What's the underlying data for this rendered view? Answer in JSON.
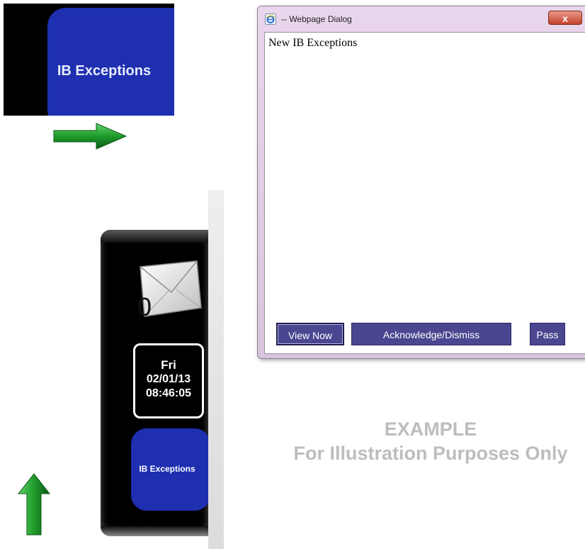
{
  "zoom": {
    "button_label": "IB Exceptions"
  },
  "sidebar": {
    "mail_count": "0",
    "clock": {
      "day": "Fri",
      "date": "02/01/13",
      "time": "08:46:05"
    },
    "ib_button_label": "IB Exceptions"
  },
  "dialog": {
    "title": "-- Webpage Dialog",
    "close_label": "x",
    "message": "New IB Exceptions",
    "buttons": {
      "view_now": "View Now",
      "acknowledge": "Acknowledge/Dismiss",
      "pass": "Pass"
    }
  },
  "watermark": {
    "line1": "EXAMPLE",
    "line2": "For Illustration Purposes Only"
  },
  "colors": {
    "button_blue": "#1e2fb0",
    "dialog_button": "#4a4690",
    "arrow_green": "#1f9b2c"
  },
  "icons": [
    "arrow-right-icon",
    "arrow-up-icon",
    "envelope-icon",
    "ie-icon",
    "close-icon"
  ]
}
